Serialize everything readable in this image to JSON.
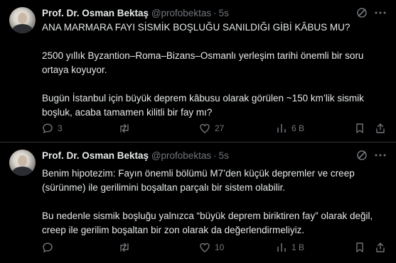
{
  "tweets": [
    {
      "author_name": "Prof. Dr. Osman Bektaş",
      "handle": "@profobektas",
      "separator": "·",
      "time": "5s",
      "paragraphs": [
        "ANA MARMARA FAYI SİSMİK BOŞLUĞU SANILDIĞI GİBİ KÂBUS MU?",
        "2500 yıllık Byzantion–Roma–Bizans–Osmanlı yerleşim tarihi önemli bir soru ortaya koyuyor.",
        "Bugün İstanbul için büyük deprem kâbusu olarak görülen ~150 km’lik sismik boşluk, acaba tamamen kilitli bir fay mı?"
      ],
      "replies": "3",
      "reposts": "",
      "likes": "27",
      "views": "6 B"
    },
    {
      "author_name": "Prof. Dr. Osman Bektaş",
      "handle": "@profobektas",
      "separator": "·",
      "time": "5s",
      "paragraphs": [
        "Benim hipotezim: Fayın önemli bölümü M7’den küçük depremler ve creep (sürünme) ile gerilimini boşaltan parçalı bir sistem olabilir.",
        "Bu nedenle sismik boşluğu yalnızca “büyük deprem biriktiren fay” olarak değil, creep ile gerilim boşaltan bir zon olarak da değerlendirmeliyiz."
      ],
      "replies": "",
      "reposts": "",
      "likes": "10",
      "views": "1 B"
    }
  ],
  "icons": {
    "grok": "grok-icon",
    "more": "more-icon",
    "reply": "reply-icon",
    "repost": "repost-icon",
    "like": "like-icon",
    "views": "views-icon",
    "bookmark": "bookmark-icon",
    "share": "share-icon"
  },
  "colors": {
    "background": "#000000",
    "text": "#e7e9ea",
    "secondary": "#71767b",
    "divider": "#2f3336"
  }
}
